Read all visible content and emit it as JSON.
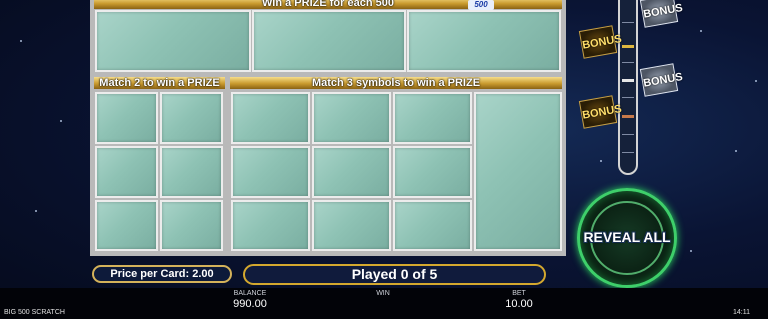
{
  "game": {
    "top_prize_header": "Win a PRIZE for each 500",
    "logo_text": "500",
    "match2_header": "Match 2 to win a PRIZE",
    "match3_header": "Match 3 symbols to win a PRIZE"
  },
  "controls": {
    "price_text": "Price per Card: 2.00",
    "played_text": "Played 0 of 5",
    "reveal_label": "REVEAL ALL"
  },
  "bonus_meter": {
    "badges": [
      "BONUS",
      "BONUS",
      "BONUS",
      "BONUS"
    ],
    "colors": {
      "gold": "#ffde6a",
      "silver": "#ffffff"
    }
  },
  "statusbar": {
    "game_name": "BIG 500 SCRATCH",
    "balance_label": "BALANCE",
    "balance_value": "990.00",
    "win_label": "WIN",
    "win_value": "",
    "bet_label": "BET",
    "bet_value": "10.00",
    "clock": "14:11"
  }
}
